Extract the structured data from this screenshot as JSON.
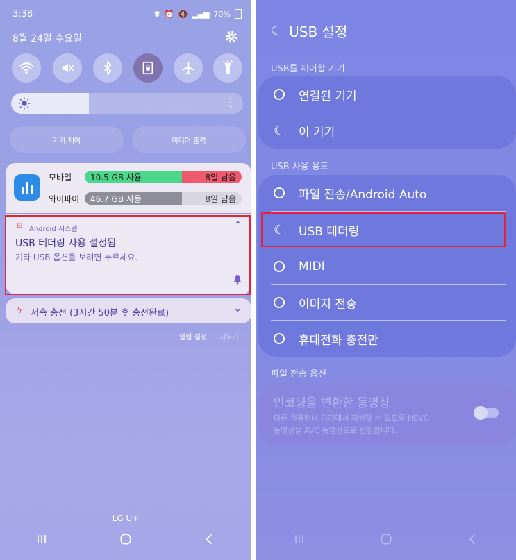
{
  "left": {
    "status": {
      "time": "3:38",
      "battery": "70%"
    },
    "date": "8월 24일 수요일",
    "device_control": "기기 제어",
    "media_output": "미디어 출력",
    "data_usage": {
      "mobile_label": "모바일",
      "mobile_used": "10.5 GB 사용",
      "mobile_days": "8일 남음",
      "wifi_label": "와이파이",
      "wifi_used": "46.7 GB 사용",
      "wifi_days": "8일 남음"
    },
    "notification": {
      "app": "Android 시스템",
      "title": "USB 테더링 사용 설정됨",
      "body": "기타 USB 옵션을 보려면 누르세요."
    },
    "charging": "저속 충전 (3시간 50분 후 충전완료)",
    "notif_settings": "알림 설정",
    "clear": "지우기",
    "carrier": "LG U+"
  },
  "right": {
    "title": "USB 설정",
    "section_control": "USB를 제어할 기기",
    "control_options": [
      "연결된 기기",
      "이 기기"
    ],
    "section_use": "USB 사용 용도",
    "use_options": [
      "파일 전송/Android Auto",
      "USB 테더링",
      "MIDI",
      "이미지 전송",
      "휴대전화 충전만"
    ],
    "section_transfer": "파일 전송 옵션",
    "transcode_title": "인코딩을 변환한 동영상",
    "transcode_desc1": "다른 컴퓨터나 기기에서 재생할 수 있도록 HEVC",
    "transcode_desc2": "동영상을 AVC 동영상으로 변환합니다."
  },
  "colors": {
    "highlight": "#e0243c",
    "mobile_green": "#4cd88a",
    "mobile_red": "#ee5a6e",
    "wifi_gray": "#8e8e98"
  }
}
